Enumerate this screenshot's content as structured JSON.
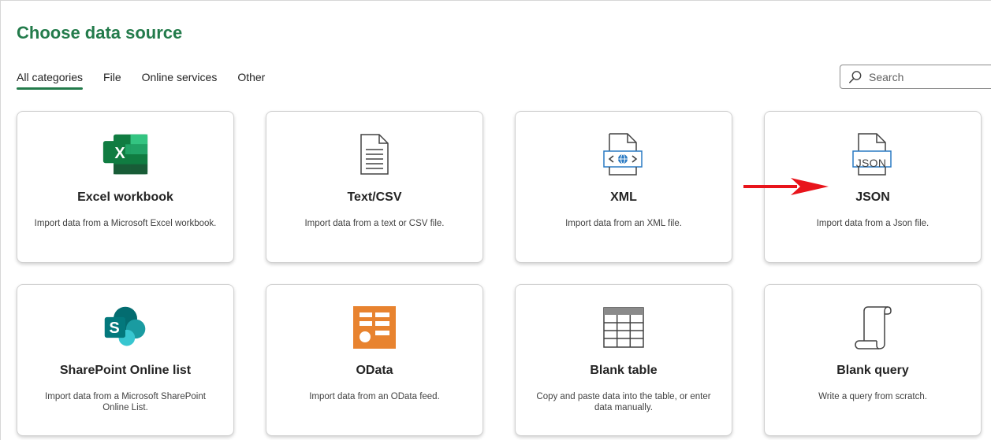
{
  "header": {
    "title": "Choose data source"
  },
  "tabs": [
    {
      "label": "All categories",
      "active": true
    },
    {
      "label": "File",
      "active": false
    },
    {
      "label": "Online services",
      "active": false
    },
    {
      "label": "Other",
      "active": false
    }
  ],
  "search": {
    "placeholder": "Search",
    "icon": "search-icon"
  },
  "sources": [
    {
      "name": "Excel workbook",
      "description": "Import data from a Microsoft Excel workbook.",
      "icon": "excel-icon"
    },
    {
      "name": "Text/CSV",
      "description": "Import data from a text or CSV file.",
      "icon": "text-file-icon"
    },
    {
      "name": "XML",
      "description": "Import data from an XML file.",
      "icon": "xml-file-icon"
    },
    {
      "name": "JSON",
      "description": "Import data from a Json file.",
      "icon": "json-file-icon",
      "icon_text": "JSON"
    },
    {
      "name": "SharePoint Online list",
      "description": "Import data from a Microsoft SharePoint Online List.",
      "icon": "sharepoint-icon",
      "icon_text": "S"
    },
    {
      "name": "OData",
      "description": "Import data from an OData feed.",
      "icon": "odata-icon"
    },
    {
      "name": "Blank table",
      "description": "Copy and paste data into the table, or enter data manually.",
      "icon": "table-icon"
    },
    {
      "name": "Blank query",
      "description": "Write a query from scratch.",
      "icon": "scroll-icon"
    }
  ],
  "excel_icon_letter": "X",
  "annotation": {
    "icon": "red-arrow-icon",
    "color": "#e8141b"
  },
  "colors": {
    "accent": "#237b4b",
    "excel": "#21a366",
    "sharepoint": "#036c70",
    "odata": "#e8832f",
    "file_blue": "#2a7ac3"
  }
}
